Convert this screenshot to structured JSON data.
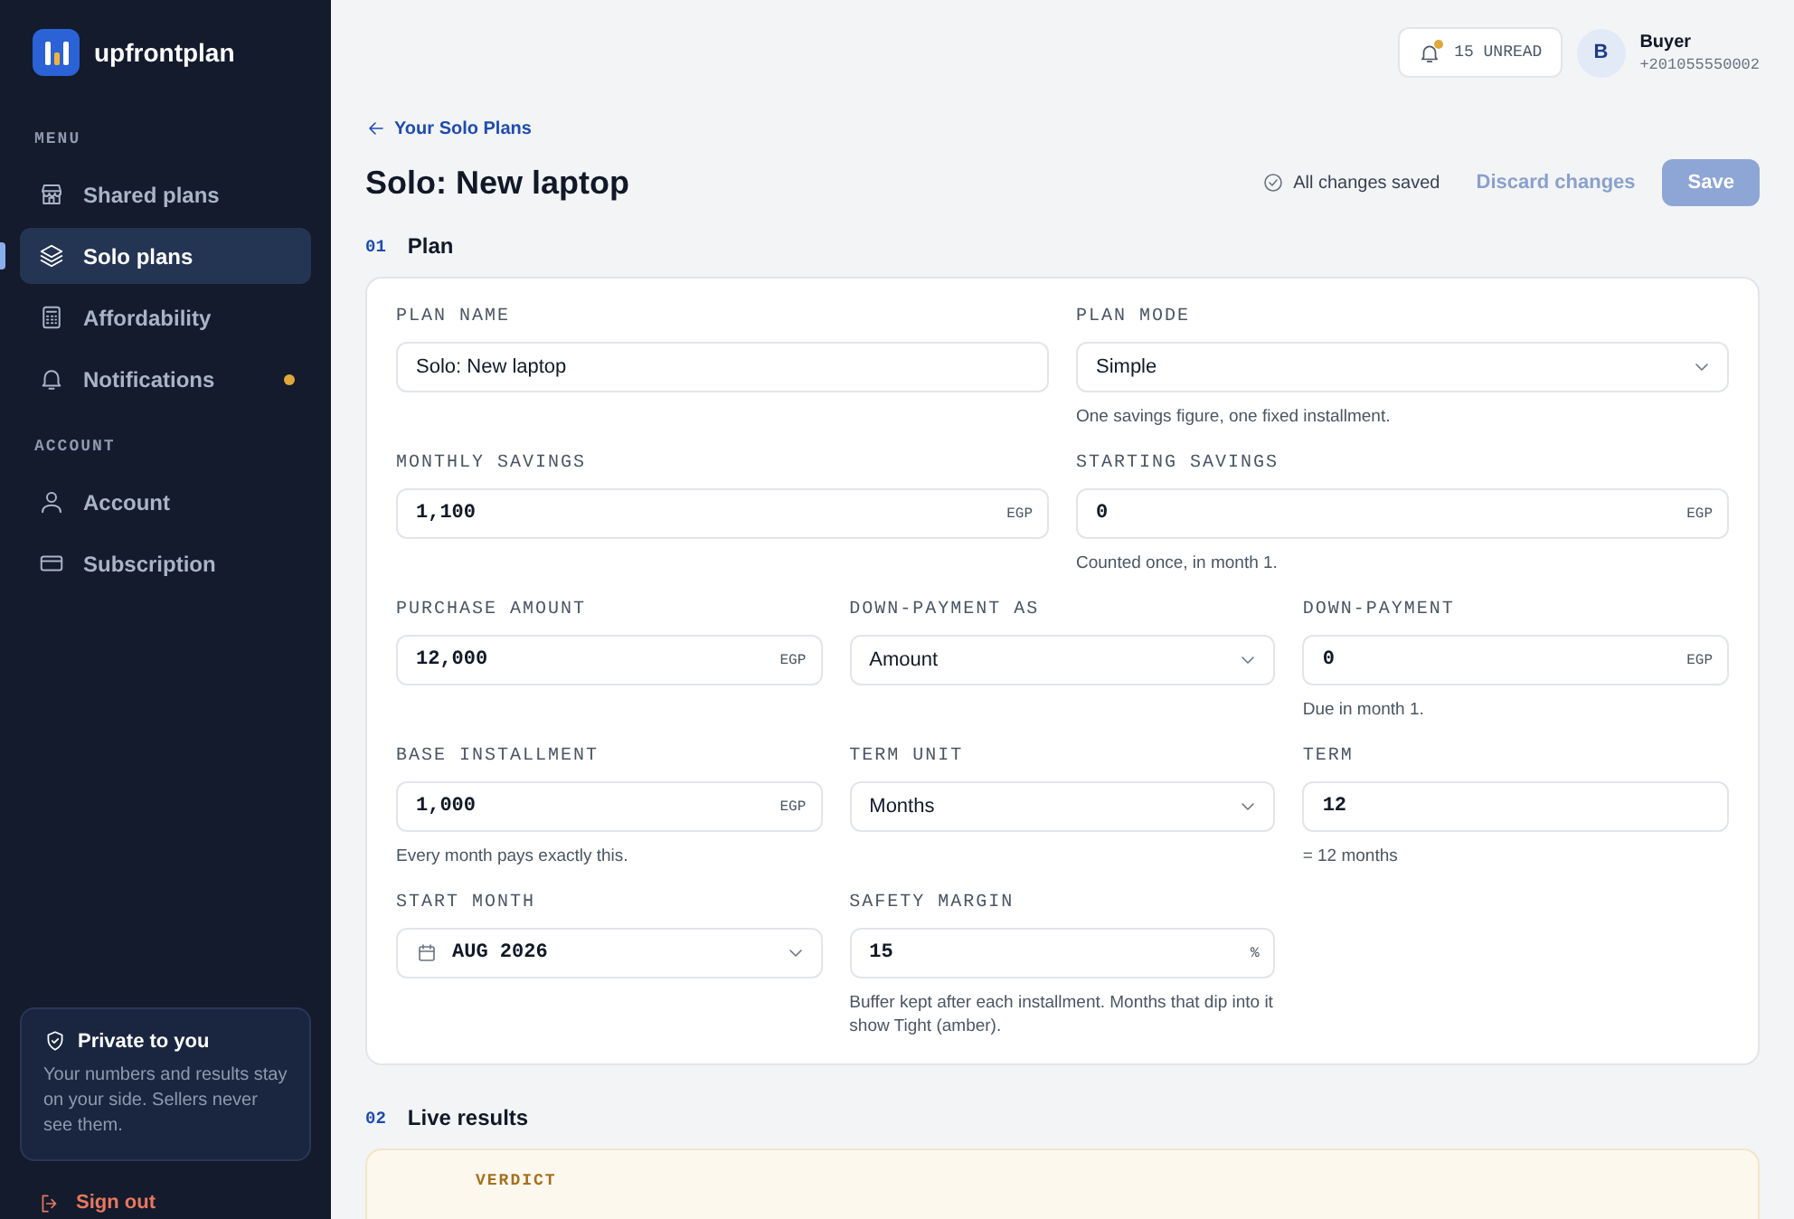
{
  "brand": {
    "name": "upfrontplan"
  },
  "sidebar": {
    "sections": [
      {
        "heading": "MENU",
        "items": [
          {
            "label": "Shared plans",
            "selected": false,
            "dot": false
          },
          {
            "label": "Solo plans",
            "selected": true,
            "dot": false
          },
          {
            "label": "Affordability",
            "selected": false,
            "dot": false
          },
          {
            "label": "Notifications",
            "selected": false,
            "dot": true
          }
        ]
      },
      {
        "heading": "ACCOUNT",
        "items": [
          {
            "label": "Account",
            "selected": false,
            "dot": false
          },
          {
            "label": "Subscription",
            "selected": false,
            "dot": false
          }
        ]
      }
    ],
    "privacy_card": {
      "title": "Private to you",
      "text": "Your numbers and results stay on your side. Sellers never see them."
    },
    "sign_out": "Sign out"
  },
  "header": {
    "notifications": "15 UNREAD",
    "user": {
      "initial": "B",
      "name": "Buyer",
      "phone": "+201055550002"
    }
  },
  "page": {
    "back_link": "Your Solo Plans",
    "title": "Solo: New laptop",
    "save_status": "All changes saved",
    "discard": "Discard changes",
    "save": "Save",
    "save_disabled": true
  },
  "plan_section": {
    "number": "01",
    "title": "Plan",
    "rows": [
      [
        {
          "label": "PLAN NAME",
          "kind": "text",
          "value": "Solo: New laptop"
        },
        {
          "label": "PLAN MODE",
          "kind": "select",
          "value": "Simple",
          "hint": "One savings figure, one fixed installment."
        }
      ],
      [
        {
          "label": "MONTHLY SAVINGS",
          "kind": "number",
          "value": "1,100",
          "unit": "EGP"
        },
        {
          "label": "STARTING SAVINGS",
          "kind": "number",
          "value": "0",
          "unit": "EGP",
          "hint": "Counted once, in month 1."
        }
      ],
      [
        {
          "label": "PURCHASE AMOUNT",
          "kind": "number",
          "value": "12,000",
          "unit": "EGP"
        },
        {
          "label": "DOWN-PAYMENT AS",
          "kind": "select",
          "value": "Amount"
        },
        {
          "label": "DOWN-PAYMENT",
          "kind": "number",
          "value": "0",
          "unit": "EGP",
          "hint": "Due in month 1."
        }
      ],
      [
        {
          "label": "BASE INSTALLMENT",
          "kind": "number",
          "value": "1,000",
          "unit": "EGP",
          "hint": "Every month pays exactly this."
        },
        {
          "label": "TERM UNIT",
          "kind": "select",
          "value": "Months"
        },
        {
          "label": "TERM",
          "kind": "number",
          "value": "12",
          "hint": "= 12 months"
        }
      ],
      [
        {
          "label": "START MONTH",
          "kind": "month",
          "value": "AUG 2026"
        },
        {
          "label": "SAFETY MARGIN",
          "kind": "number",
          "value": "15",
          "unit": "%",
          "hint": "Buffer kept after each installment. Months that dip into it show Tight (amber)."
        }
      ]
    ]
  },
  "results_section": {
    "number": "02",
    "title": "Live results",
    "verdict_label": "VERDICT"
  }
}
